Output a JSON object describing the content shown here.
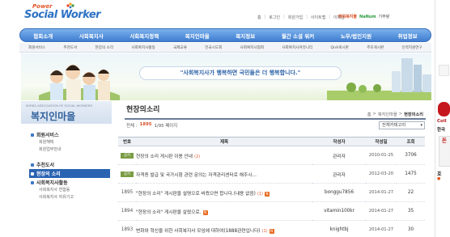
{
  "logo": {
    "top": "Power",
    "main": "Social Worker"
  },
  "toplinks": [
    "홈",
    "로그인",
    "회원가입",
    "사이트맵",
    "이메일"
  ],
  "partner": {
    "a": "파워복지몰",
    "b": "NaNum",
    "c": "기부랑"
  },
  "gnb": [
    "협회소개",
    "사회복지사",
    "사회복지정책",
    "복지인마을",
    "복지정보",
    "월간 소셜 워커",
    "노무/법인지원",
    "취업정보"
  ],
  "subnav": [
    "회원서비스",
    "추천도서",
    "현장의 소리",
    "사회복지사활동",
    "국제교류",
    "전국시도회",
    "사회복지사협회",
    "사회복지사커뮤니티",
    "QnA게시판",
    "추모게시판",
    "인력지원연구"
  ],
  "banner": {
    "slogan": "\"사회복지사가 행복하면 국민들은 더 행복합니다.\""
  },
  "sidebar": {
    "eng": "KOREA ASSOCIATION OF SOCIAL WORKERS",
    "title": "복지인마을",
    "s1": "회원서비스",
    "s1a": "회원혜택",
    "s1b": "회원업무안내",
    "s2": "추천도서",
    "s3": "현장의 소리",
    "s4": "사회복지사활동",
    "s4a": "사회복지사 연합동",
    "s4b": "사회복지사 자유기고"
  },
  "content": {
    "title": "현장의소리",
    "breadcrumb": [
      "홈",
      ">",
      "복지인마을",
      ">",
      "현장의소리"
    ],
    "counts": {
      "label": "전체 :",
      "total": "1895",
      "page": "1/95 페이지"
    },
    "category": "전체카테고리",
    "columns": [
      "번호",
      "제목",
      "작성자",
      "작성일",
      "조회"
    ],
    "rows": [
      {
        "no": "공지",
        "title": "현장의 소리 게시판 이용 안내",
        "comments": "(2)",
        "author": "관리자",
        "date": "2010-01-25",
        "views": "3706",
        "notice": true,
        "new": false
      },
      {
        "no": "공지",
        "title": "자격증 발급 및 국가시험 관련 문의는 자격관리센터로 해주시...",
        "comments": "",
        "author": "관리자",
        "date": "2012-03-20",
        "views": "1475",
        "notice": true,
        "new": false
      },
      {
        "no": "1895",
        "title": "\"현장의 소리\" 게시판을 설명으로 바꿨으면 합니다.(내용 없음)",
        "comments": "(1)",
        "author": "bonggu7856",
        "date": "2014-01-27",
        "views": "22",
        "notice": false,
        "new": true
      },
      {
        "no": "1894",
        "title": "\"현장의 소리\" 게시판을 살렸으로.",
        "comments": "",
        "author": "vitamin100kr",
        "date": "2014-01-27",
        "views": "35",
        "notice": false,
        "new": true
      },
      {
        "no": "1893",
        "title": "변화와 혁신을 위한 사회복지사 모임에 대하여(1888관련입니다)",
        "comments": "(1)",
        "author": "knightbj",
        "date": "2014-01-27",
        "views": "30",
        "notice": false,
        "new": true
      }
    ]
  },
  "rightbar": {
    "coll": "Coll",
    "han": "한국",
    "tab": "돈",
    "ho": "호",
    "dot": "●"
  },
  "colors": {
    "primary": "#3f7dd0",
    "accent": "#d6502b",
    "notice": "#7a9c44"
  }
}
